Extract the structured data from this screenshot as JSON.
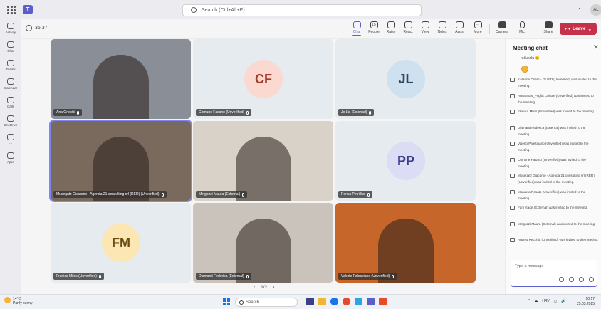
{
  "titlebar": {
    "search_placeholder": "Search (Ctrl+Alt+E)",
    "more": "···",
    "user_initials": "AL"
  },
  "rail": [
    {
      "label": "Activity"
    },
    {
      "label": "Chat"
    },
    {
      "label": "Teams"
    },
    {
      "label": "Calendar"
    },
    {
      "label": "Calls"
    },
    {
      "label": "OneDrive"
    },
    {
      "label": "···"
    },
    {
      "label": "Apps"
    }
  ],
  "toolbar": {
    "timer": "36:37",
    "tools": [
      {
        "label": "Chat",
        "glyph": "",
        "active": true
      },
      {
        "label": "People",
        "glyph": "15",
        "active": false
      },
      {
        "label": "Raise",
        "glyph": "",
        "active": false
      },
      {
        "label": "React",
        "glyph": "",
        "active": false
      },
      {
        "label": "View",
        "glyph": "",
        "active": false
      },
      {
        "label": "Notes",
        "glyph": "",
        "active": false
      },
      {
        "label": "Apps",
        "glyph": "",
        "active": false
      },
      {
        "label": "More",
        "glyph": "···",
        "active": false
      }
    ],
    "camera_label": "Camera",
    "mic_label": "Mic",
    "share_label": "Share",
    "leave_label": "Leave"
  },
  "tiles": [
    {
      "name": "Ana Orlović",
      "initials": "",
      "kind": "video",
      "bg": "#8a8f97"
    },
    {
      "name": "Comune Fasano (Unverified)",
      "initials": "CF",
      "kind": "avatar",
      "avatar_bg": "#fcd9d0",
      "avatar_fg": "#a43a2a"
    },
    {
      "name": "Jo Lia (External)",
      "initials": "JL",
      "kind": "avatar",
      "avatar_bg": "#cfe0ee",
      "avatar_fg": "#2b4a63"
    },
    {
      "name": "Musegatz Giacomo - Agenda 21 consulting srl (RER) (Unverified)",
      "initials": "",
      "kind": "video",
      "bg": "#7a6a5d",
      "speaking": true
    },
    {
      "name": "Mingozzi Maura (External)",
      "initials": "",
      "kind": "video",
      "bg": "#d9d2c8"
    },
    {
      "name": "Perica Petričko",
      "initials": "PP",
      "kind": "avatar",
      "avatar_bg": "#dcdcf5",
      "avatar_fg": "#3b3f8a"
    },
    {
      "name": "Franica Milos (Unverified)",
      "initials": "FM",
      "kind": "avatar",
      "avatar_bg": "#fbe6b4",
      "avatar_fg": "#6b4a10"
    },
    {
      "name": "Diamanti Federica (External)",
      "initials": "",
      "kind": "video",
      "bg": "#c9c3bb"
    },
    {
      "name": "Valerio Palesciano (Unverified)",
      "initials": "",
      "kind": "video",
      "bg": "#c7662b"
    }
  ],
  "pager": {
    "prev": "‹",
    "label": "1/2",
    "next": "›"
  },
  "chat": {
    "title": "Meeting chat",
    "close": "✕",
    "top_text": "računalu 😊",
    "messages": [
      "Katarina Orbac - GUSTI (Unverified) was invited to the meeting.",
      "Anna Stas_Puglia Culture (Unverified) was invited to the meeting.",
      "Franica Milos (Unverified) was invited to the meeting.",
      "Diamanti Federica (External) was invited to the meeting.",
      "Valerio Palesciano (Unverified) was invited to the meeting.",
      "Comune Fasano (Unverified) was invited to the meeting.",
      "Musegatz Giacomo - Agenda 21 consulting srl (RER) (Unverified) was invited to the meeting.",
      "Manuela Rosato (Unverified) was invited to the meeting.",
      "Fani Gade (External) was invited to the meeting.",
      "Mingozzi Maura (External) was invited to the meeting.",
      "Angelo Recchia (Unverified) was invited to the meeting."
    ],
    "compose_placeholder": "Type a message"
  },
  "taskbar": {
    "weather_temp": "14°C",
    "weather_desc": "Partly sunny",
    "search_label": "Search",
    "tray_items": [
      "^",
      "☁",
      "HRV",
      "◻",
      "🔊"
    ],
    "time": "10:17",
    "date": "25.03.2025"
  }
}
